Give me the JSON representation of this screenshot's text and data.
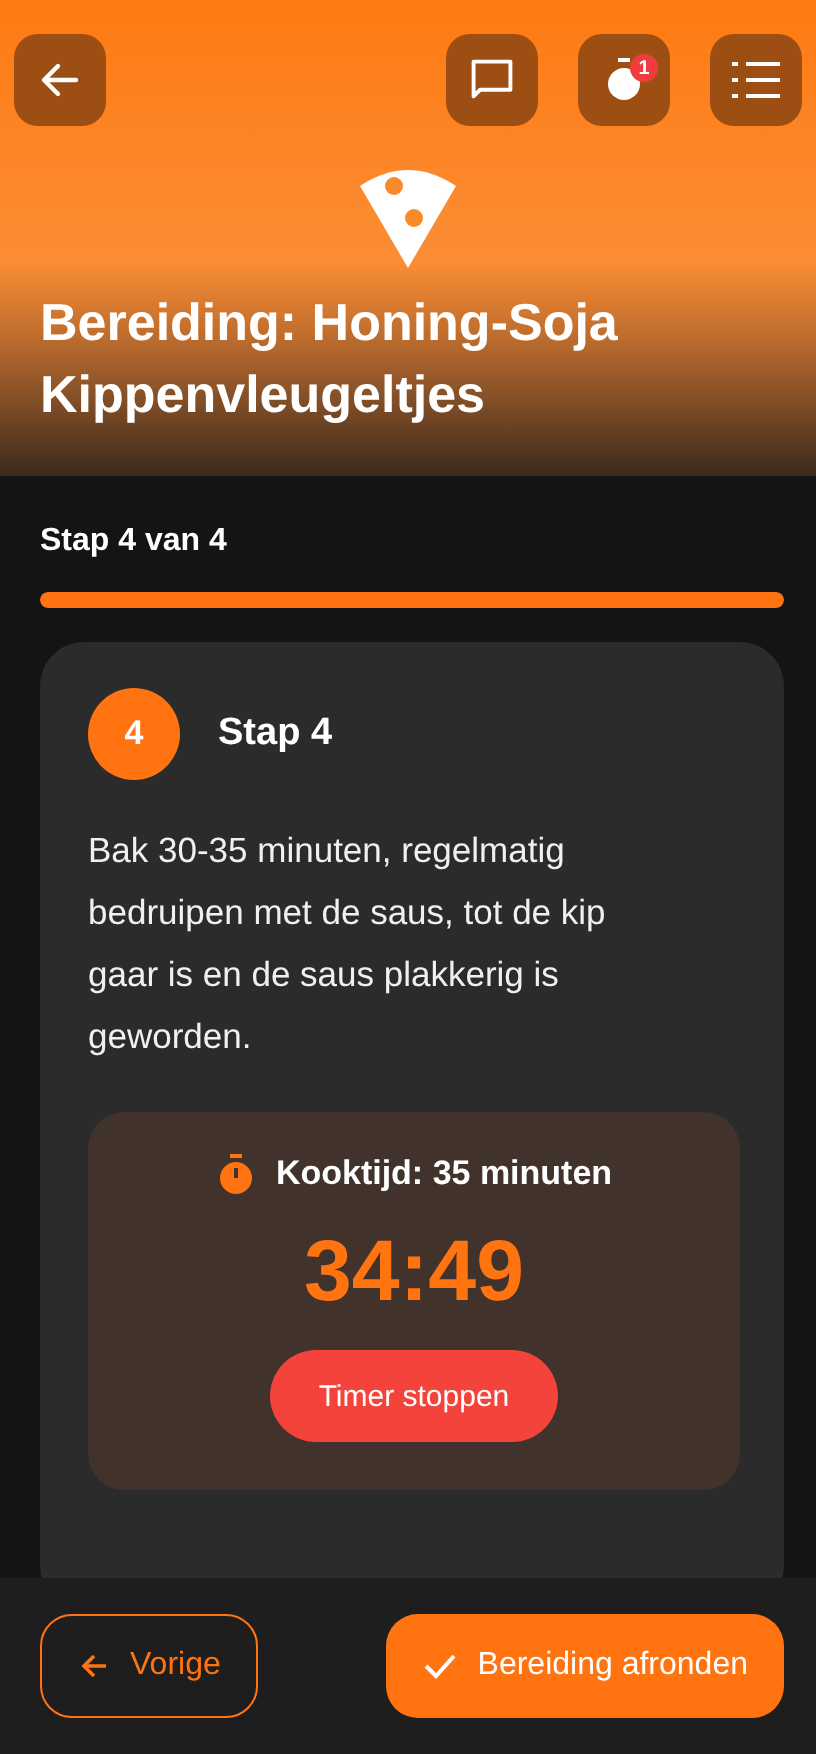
{
  "header": {
    "title": "Bereiding: Honing-Soja Kippenvleugeltjes",
    "timer_badge": "1"
  },
  "progress": {
    "label": "Stap 4 van 4",
    "level": 1.0
  },
  "step": {
    "number": "4",
    "title": "Stap 4",
    "text": "Bak 30-35 minuten, regelmatig bedruipen met de saus, tot de kip gaar is en de saus plakkerig is geworden."
  },
  "timer": {
    "label": "Kooktijd: 35 minuten",
    "time": "34:49",
    "button": "Timer stoppen"
  },
  "footer": {
    "previous": "Vorige",
    "finish": "Bereiding afronden"
  }
}
